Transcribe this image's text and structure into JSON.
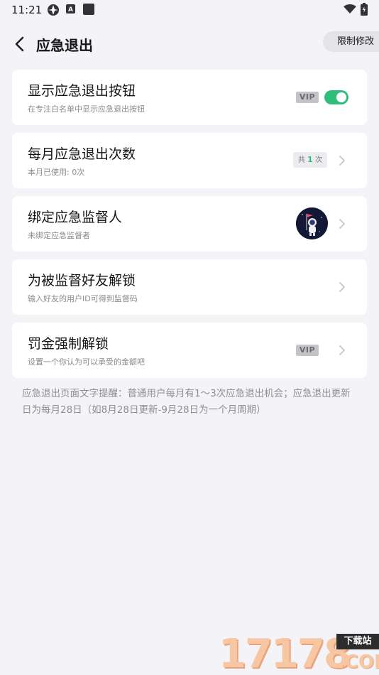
{
  "status_bar": {
    "time": "11:21",
    "icons": [
      "app-icon",
      "accessibility-icon",
      "app-square-icon",
      "wifi-icon",
      "battery-icon"
    ]
  },
  "header": {
    "title": "应急退出",
    "limit_button": "限制修改"
  },
  "cards": [
    {
      "title": "显示应急退出按钮",
      "subtitle": "在专注白名单中显示应急退出按钮",
      "vip": "VIP",
      "toggle_on": true
    },
    {
      "title": "每月应急退出次数",
      "subtitle": "本月已使用: 0次",
      "count_prefix": "共",
      "count_num": "1",
      "count_suffix": "次"
    },
    {
      "title": "绑定应急监督人",
      "subtitle": "未绑定应急监督者",
      "avatar": "astronaut-avatar"
    },
    {
      "title": "为被监督好友解锁",
      "subtitle": "输入好友的用户ID可得到监督码"
    },
    {
      "title": "罚金强制解锁",
      "subtitle": "设置一个你认为可以承受的金额吧",
      "vip": "VIP"
    }
  ],
  "note": "应急退出页面文字提醒：普通用户每月有1～3次应急退出机会；应急退出更新日为每月28日（如8月28日更新-9月28日为一个月周期）",
  "watermark": {
    "digits": "17178",
    "tag": "下载站",
    "suffix": ".COM"
  },
  "colors": {
    "accent_green": "#2fbf7a",
    "background": "#f4f4f8",
    "card": "#ffffff",
    "vip_badge": "#c4c4c8"
  }
}
